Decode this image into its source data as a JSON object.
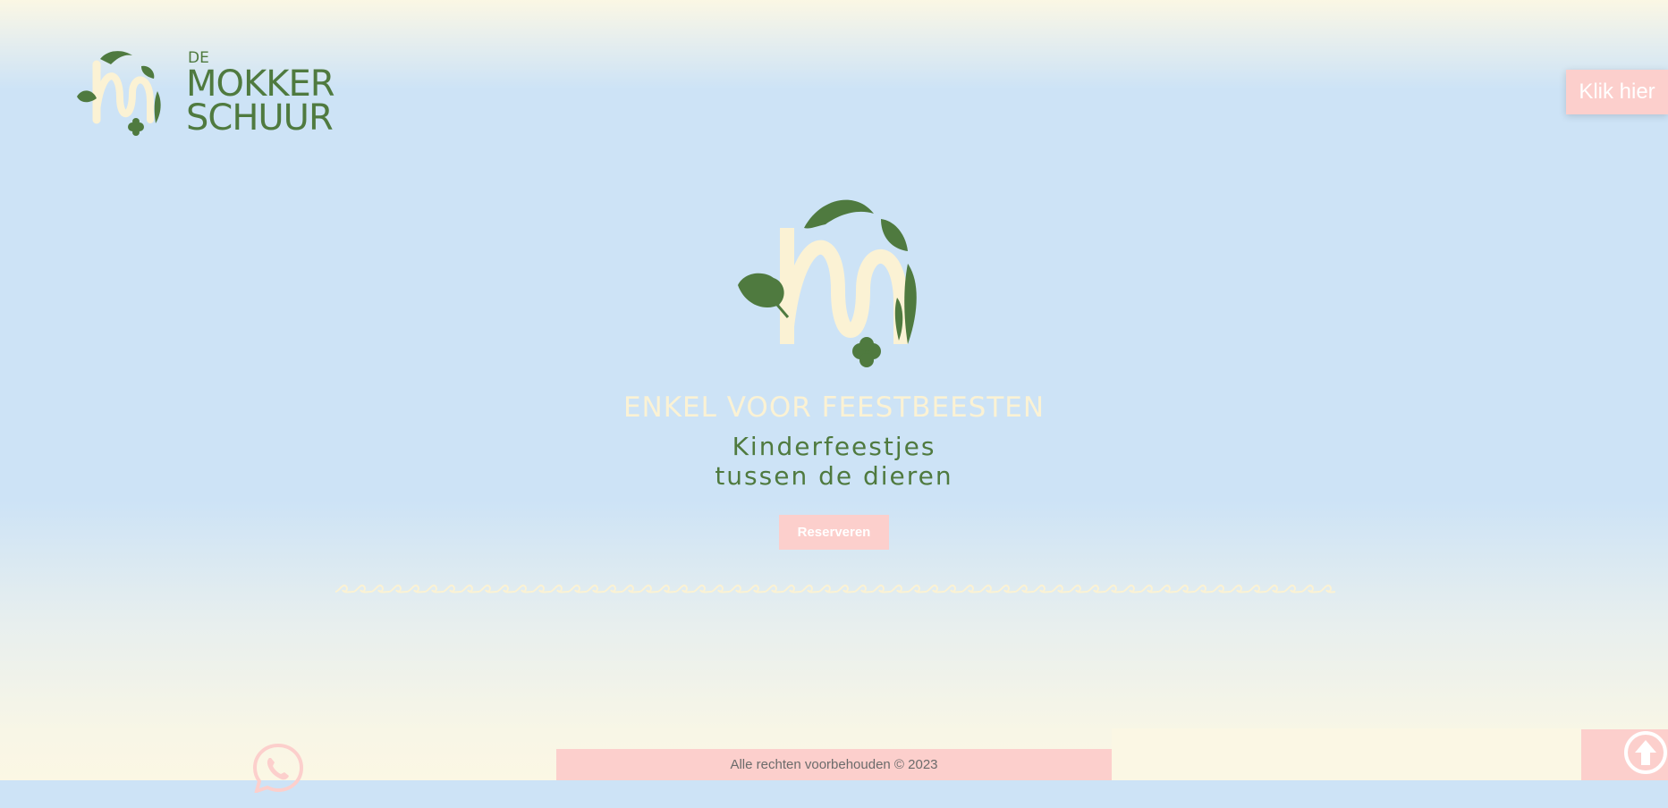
{
  "brand": {
    "logo_small": "DE",
    "logo_line1": "MOKKER",
    "logo_line2": "SCHUUR"
  },
  "header": {
    "cta_label": "Klik hier"
  },
  "hero": {
    "tagline": "ENKEL VOOR FEESTBEESTEN",
    "subtitle": "Kinderfeestjes\ntussen de dieren",
    "button_label": "Reserveren"
  },
  "footer": {
    "copyright": "Alle rechten voorbehouden © 2023"
  },
  "icons": {
    "whatsapp": "whatsapp-icon",
    "scroll_top": "arrow-up-circle-icon"
  },
  "colors": {
    "green": "#4f7a3f",
    "cream": "#fbf2d4",
    "pink": "#fccfcc",
    "sky": "#cde3f6"
  }
}
